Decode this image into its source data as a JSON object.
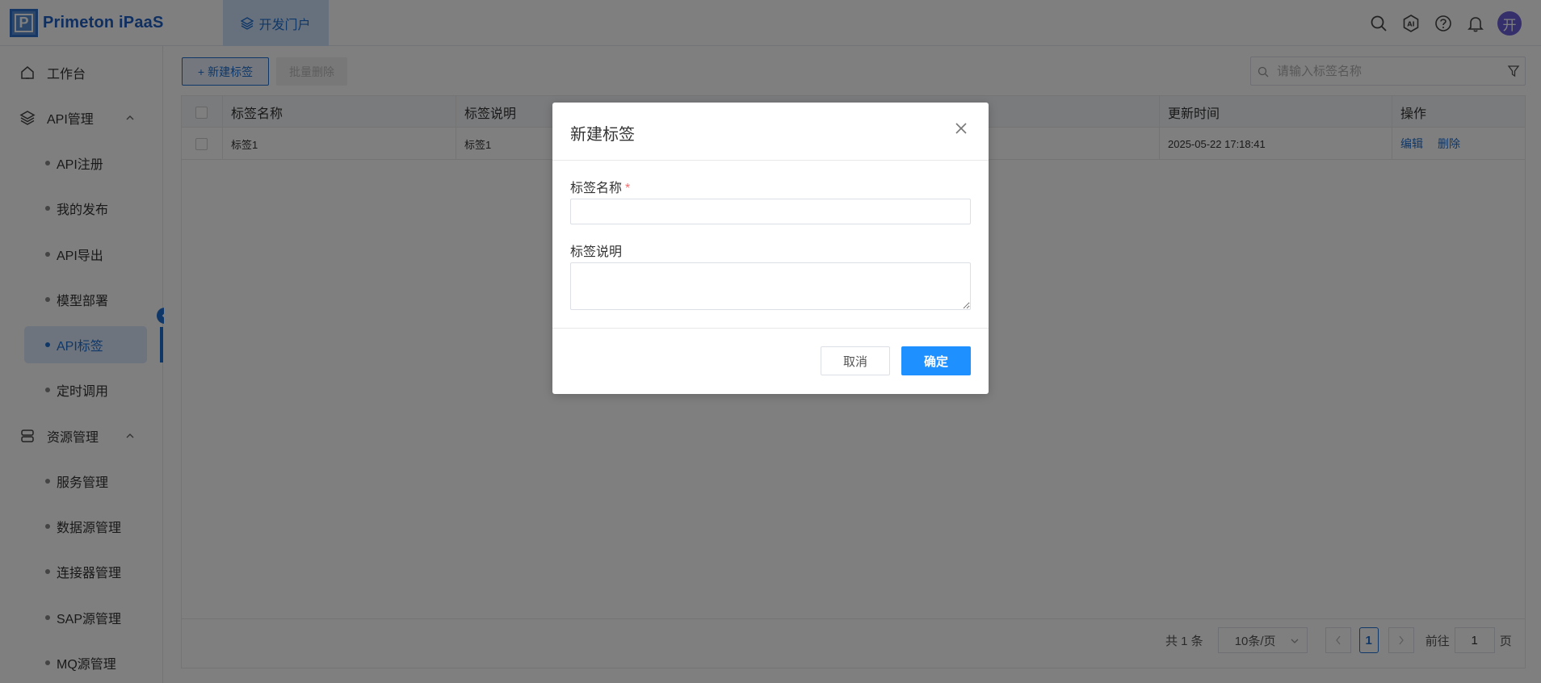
{
  "header": {
    "logo_letter": "P",
    "logo_text": "Primeton iPaaS",
    "nav_tab": "开发门户",
    "avatar": "开",
    "icons": [
      "search-icon",
      "ai-icon",
      "help-icon",
      "bell-icon"
    ]
  },
  "sidebar": {
    "workbench": "工作台",
    "api_group": "API管理",
    "api_items": [
      "API注册",
      "我的发布",
      "API导出",
      "模型部署",
      "API标签",
      "定时调用"
    ],
    "resource_group": "资源管理",
    "resource_items": [
      "服务管理",
      "数据源管理",
      "连接器管理",
      "SAP源管理",
      "MQ源管理"
    ],
    "active_item": "API标签"
  },
  "toolbar": {
    "new_button": "新建标签",
    "batch_delete": "批量删除",
    "search_placeholder": "请输入标签名称"
  },
  "table": {
    "headers": [
      "标签名称",
      "标签说明",
      "更新时间",
      "操作"
    ],
    "rows": [
      {
        "name": "标签1",
        "desc": "标签1",
        "time": "2025-05-22 17:18:41",
        "actions": [
          "编辑",
          "删除"
        ]
      }
    ]
  },
  "pagination": {
    "total": "共 1 条",
    "page_size": "10条/页",
    "current": "1",
    "goto_label": "前往",
    "goto_value": "1",
    "page_suffix": "页"
  },
  "dialog": {
    "title": "新建标签",
    "name_label": "标签名称",
    "required_mark": "*",
    "name_value": "",
    "desc_label": "标签说明",
    "desc_value": "",
    "cancel": "取消",
    "confirm": "确定"
  },
  "colors": {
    "primary": "#1f6fd1",
    "confirm": "#1e90ff",
    "required": "#f56c6c"
  }
}
